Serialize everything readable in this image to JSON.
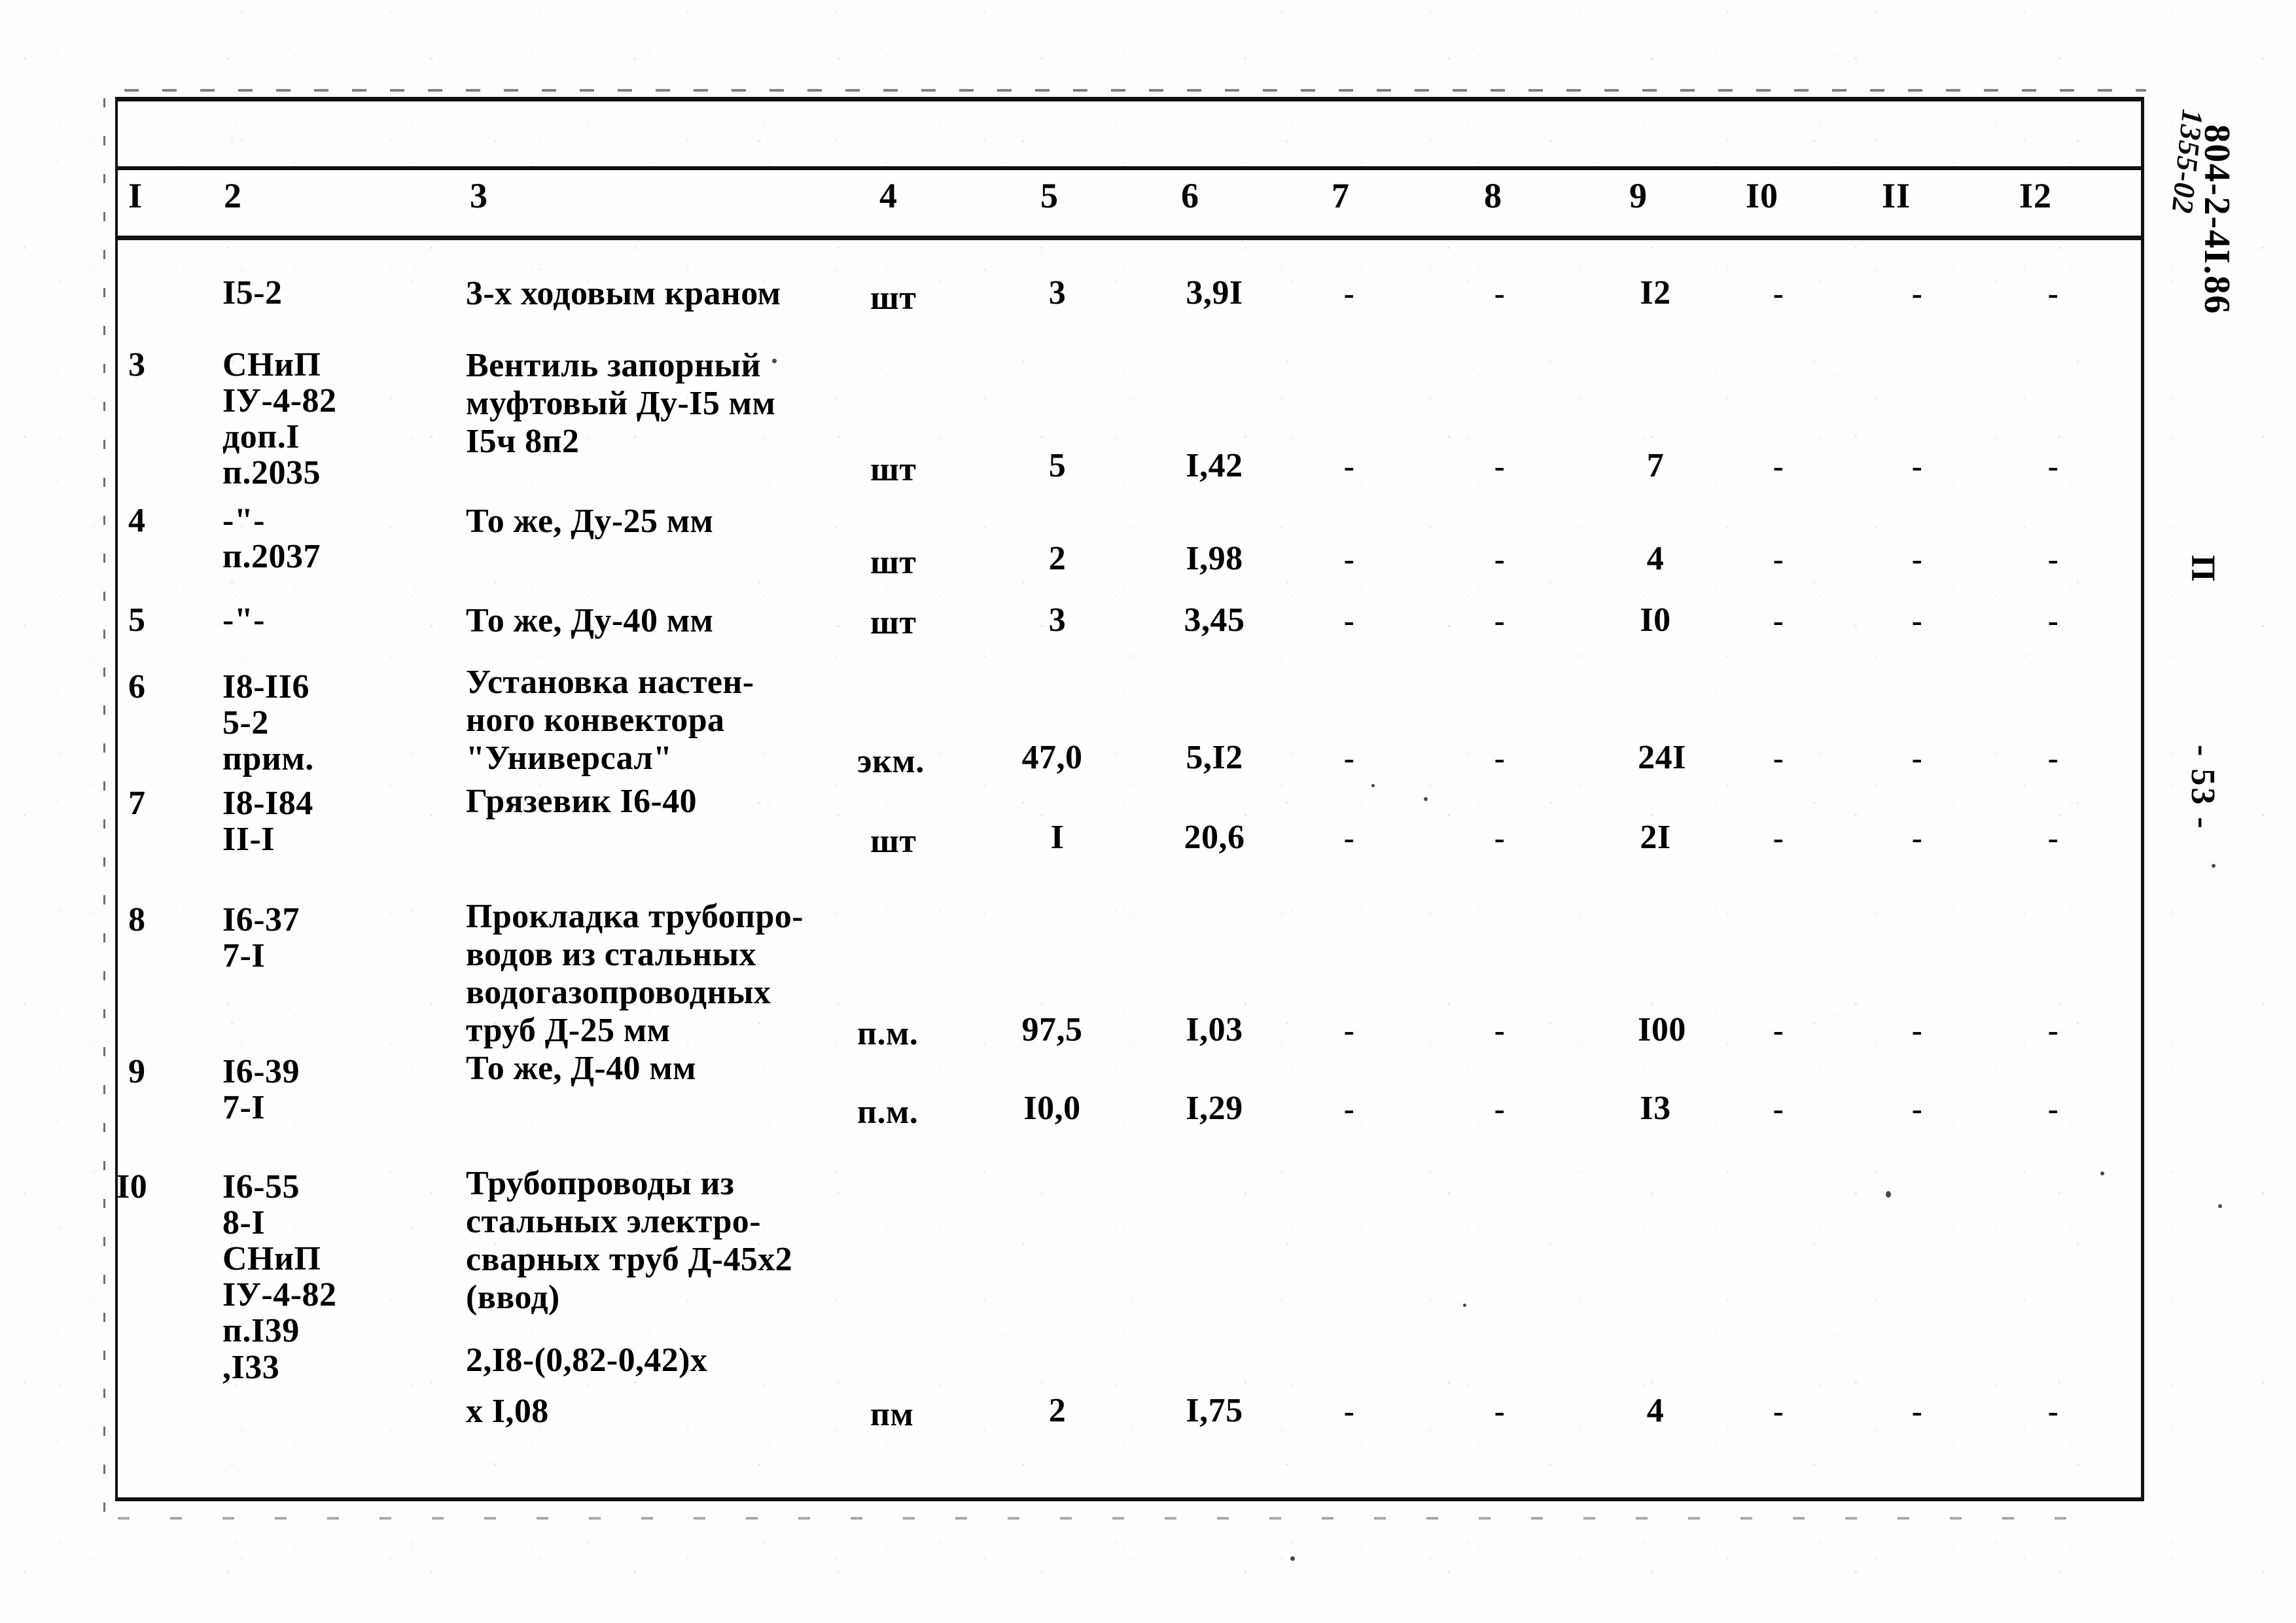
{
  "document": {
    "code": "804-2-4I.86",
    "handwritten_code": "1355-02",
    "sheet_mark": "П",
    "page_number": "- 53 -"
  },
  "table": {
    "column_headers": [
      "I",
      "2",
      "3",
      "4",
      "5",
      "6",
      "7",
      "8",
      "9",
      "I0",
      "II",
      "I2"
    ],
    "rows": [
      {
        "num": "",
        "code": "I5-2",
        "description": [
          "3-х ходовым краном"
        ],
        "unit": "шт",
        "qty": "3",
        "c6": "3,9I",
        "c7": "-",
        "c8": "-",
        "c9": "I2",
        "c10": "-",
        "c11": "-",
        "c12": "-"
      },
      {
        "num": "3",
        "code": "СНиП\nIУ-4-82\nдоп.I\nп.2035",
        "description": [
          "Вентиль запорный",
          "муфтовый Ду-I5 мм",
          "I5ч 8п2"
        ],
        "unit": "шт",
        "qty": "5",
        "c6": "I,42",
        "c7": "-",
        "c8": "-",
        "c9": "7",
        "c10": "-",
        "c11": "-",
        "c12": "-"
      },
      {
        "num": "4",
        "code": "-\"-\nп.2037",
        "description": [
          "То же, Ду-25 мм"
        ],
        "unit": "шт",
        "qty": "2",
        "c6": "I,98",
        "c7": "-",
        "c8": "-",
        "c9": "4",
        "c10": "-",
        "c11": "-",
        "c12": "-"
      },
      {
        "num": "5",
        "code": "-\"-",
        "description": [
          "То же, Ду-40 мм"
        ],
        "unit": "шт",
        "qty": "3",
        "c6": "3,45",
        "c7": "-",
        "c8": "-",
        "c9": "I0",
        "c10": "-",
        "c11": "-",
        "c12": "-"
      },
      {
        "num": "6",
        "code": "I8-II6\n5-2\nприм.",
        "description": [
          "Установка настен-",
          "ного конвектора",
          "\"Универсал\""
        ],
        "unit": "экм.",
        "qty": "47,0",
        "c6": "5,I2",
        "c7": "-",
        "c8": "-",
        "c9": "24I",
        "c10": "-",
        "c11": "-",
        "c12": "-"
      },
      {
        "num": "7",
        "code": "I8-I84\nII-I",
        "description": [
          "Грязевик I6-40"
        ],
        "unit": "шт",
        "qty": "I",
        "c6": "20,6",
        "c7": "-",
        "c8": "-",
        "c9": "2I",
        "c10": "-",
        "c11": "-",
        "c12": "-"
      },
      {
        "num": "8",
        "code": "I6-37\n7-I",
        "description": [
          "Прокладка трубопро-",
          "водов из стальных",
          "водогазопроводных",
          "труб Д-25 мм"
        ],
        "unit": "п.м.",
        "qty": "97,5",
        "c6": "I,03",
        "c7": "-",
        "c8": "-",
        "c9": "I00",
        "c10": "-",
        "c11": "-",
        "c12": "-"
      },
      {
        "num": "9",
        "code": "I6-39\n7-I",
        "description": [
          "То же, Д-40 мм"
        ],
        "unit": "п.м.",
        "qty": "I0,0",
        "c6": "I,29",
        "c7": "-",
        "c8": "-",
        "c9": "I3",
        "c10": "-",
        "c11": "-",
        "c12": "-"
      },
      {
        "num": "I0",
        "code": "I6-55\n8-I\nСНиП\nIУ-4-82\nп.I39\n,I33",
        "description": [
          "Трубопроводы из",
          "стальных электро-",
          "сварных труб Д-45х2",
          "(ввод)"
        ],
        "formula_line1": "2,I8-(0,82-0,42)х",
        "formula_line2": "х I,08",
        "unit": "пм",
        "qty": "2",
        "c6": "I,75",
        "c7": "-",
        "c8": "-",
        "c9": "4",
        "c10": "-",
        "c11": "-",
        "c12": "-"
      }
    ]
  }
}
